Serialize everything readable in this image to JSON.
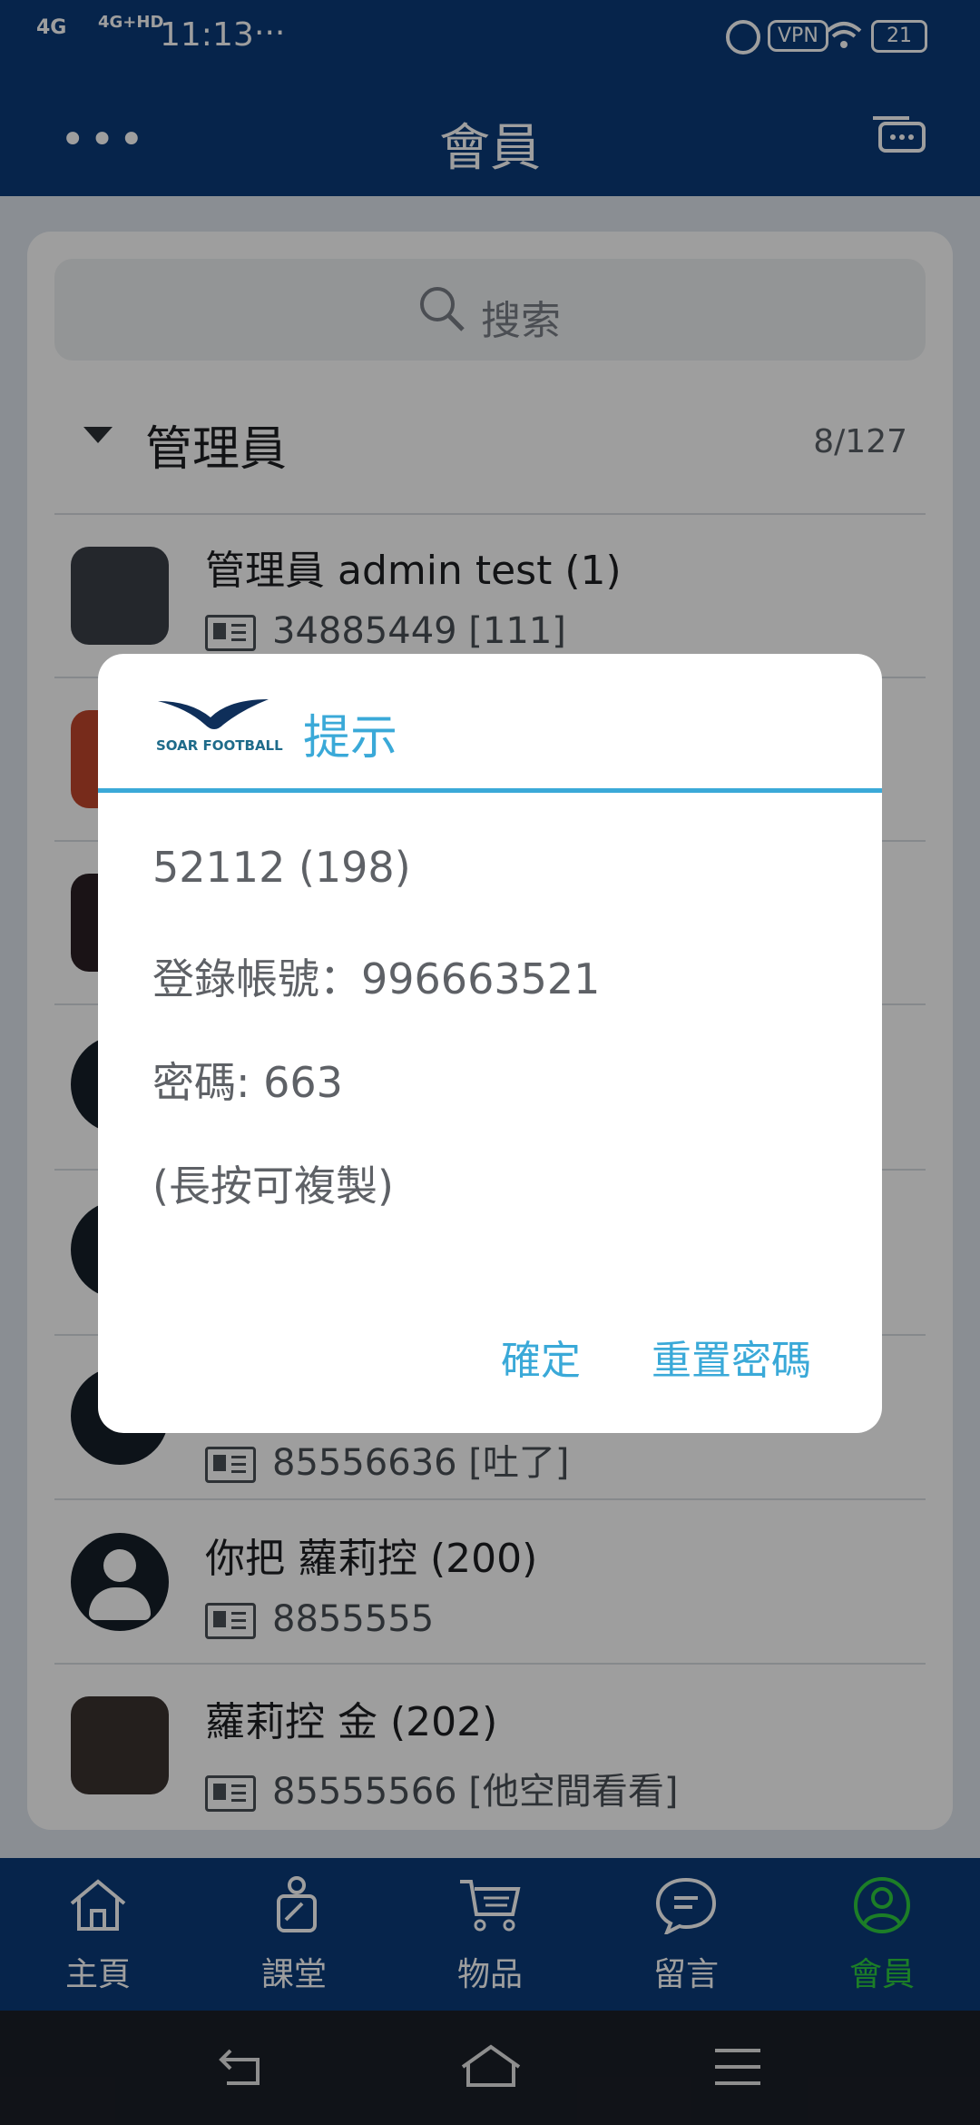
{
  "status": {
    "network1": "4G",
    "network2": "4G+HD",
    "time": "11:13",
    "more": "···",
    "vpn": "VPN",
    "battery": "21"
  },
  "header": {
    "title": "會員",
    "menu_icon": "more-dots-icon",
    "chat_icon": "chat-bubbles-icon"
  },
  "search": {
    "placeholder": "搜索"
  },
  "group": {
    "title": "管理員",
    "count": "8/127"
  },
  "members": [
    {
      "name": "管理員 admin test (1)",
      "id": "34885449 [111]",
      "avatar": "photo-keyboard"
    },
    {
      "name": "",
      "id": "",
      "avatar": "photo-car"
    },
    {
      "name": "",
      "id": "",
      "avatar": "photo-people"
    },
    {
      "name": "",
      "id": "",
      "avatar": "default"
    },
    {
      "name": "",
      "id": "",
      "avatar": "default"
    },
    {
      "name": "",
      "id": "85556636 [吐了]",
      "avatar": "default"
    },
    {
      "name": "你把 蘿莉控 (200)",
      "id": "8855555",
      "avatar": "default"
    },
    {
      "name": "蘿莉控 金 (202)",
      "id": "85555566 [他空間看看]",
      "avatar": "photo-woman"
    }
  ],
  "dialog": {
    "logo_text": "SOAR FOOTBALL",
    "title": "提示",
    "line1": "52112 (198)",
    "line2": "登錄帳號：996663521",
    "line3": "密碼: 663",
    "line4": "(長按可複製)",
    "ok": "確定",
    "reset": "重置密碼"
  },
  "tabs": [
    {
      "label": "主頁",
      "icon": "home-icon",
      "active": false
    },
    {
      "label": "課堂",
      "icon": "class-icon",
      "active": false
    },
    {
      "label": "物品",
      "icon": "cart-icon",
      "active": false
    },
    {
      "label": "留言",
      "icon": "message-icon",
      "active": false
    },
    {
      "label": "會員",
      "icon": "member-icon",
      "active": true
    }
  ],
  "colors": {
    "brand": "#0b3b79",
    "accent": "#3aa9d8",
    "active_tab": "#2ecc40"
  }
}
